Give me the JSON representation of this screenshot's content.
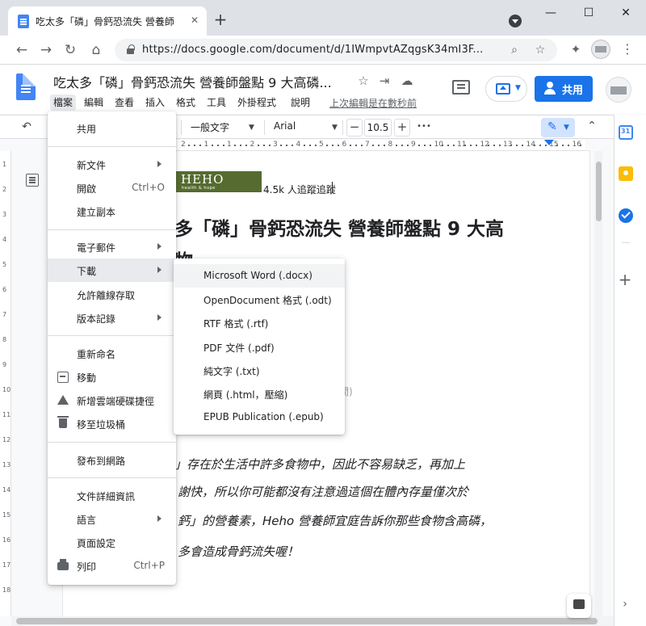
{
  "browser": {
    "tab_title": "吃太多「磷」骨鈣恐流失 營養師",
    "tab_close": "✕",
    "new_tab": "+",
    "window_min": "—",
    "window_max": "☐",
    "window_close": "✕",
    "back": "←",
    "forward": "→",
    "reload": "↻",
    "home": "⌂",
    "url": "https://docs.google.com/document/d/1IWmpvtAZqgsK34mI3F...",
    "zoom_icon": "⌕",
    "star_icon": "☆",
    "extensions_icon": "✦",
    "menu_icon": "⋮"
  },
  "docs": {
    "title": "吃太多「磷」骨鈣恐流失 營養師盤點 9 大高磷...",
    "star_icon": "☆",
    "move_icon": "⇥",
    "cloud_icon": "☁",
    "menus": [
      "檔案",
      "編輯",
      "查看",
      "插入",
      "格式",
      "工具",
      "外掛程式",
      "說明"
    ],
    "last_edit": "上次編輯是在數秒前",
    "share_label": "共用"
  },
  "toolbar": {
    "undo": "↶",
    "style": "一般文字",
    "font": "Arial",
    "size": "10.5",
    "size_minus": "−",
    "size_plus": "+",
    "more": "•••",
    "edit_mode_icon": "✎",
    "collapse": "⌃"
  },
  "ruler": {
    "labels": [
      "2",
      "1",
      "1",
      "2",
      "3",
      "4",
      "5",
      "6",
      "7",
      "8",
      "9",
      "10",
      "11",
      "12",
      "13",
      "14",
      "15",
      "16"
    ],
    "left_labels": [
      "1",
      "2",
      "3",
      "4",
      "5",
      "6",
      "7",
      "8",
      "9",
      "10",
      "11",
      "12",
      "13",
      "14",
      "15",
      "16",
      "17",
      "18"
    ]
  },
  "document": {
    "logo_brand": "HEHO",
    "logo_tagline": "health & hope",
    "followers": "4.5k 人追蹤追蹤",
    "headline_line1": "多「磷」骨鈣恐流失 營養師盤點 9 大高",
    "headline_line2": "物",
    "faint_fragment": "間)",
    "body_lines": [
      "「磷」存在於生活中許多食物中，因此不容易缺乏，再加上",
      "謝快，所以你可能都沒有注意過這個在體內存量僅次於",
      "鈣」的營養素，Heho 營養師宜庭告訴你那些食物含高磷，",
      "多會造成骨鈣流失喔！"
    ]
  },
  "file_menu": {
    "items": [
      {
        "label": "共用",
        "shortcut": "",
        "arrow": false
      },
      {
        "label": "新文件",
        "shortcut": "",
        "arrow": true
      },
      {
        "label": "開啟",
        "shortcut": "Ctrl+O",
        "arrow": false
      },
      {
        "label": "建立副本",
        "shortcut": "",
        "arrow": false
      },
      {
        "label": "電子郵件",
        "shortcut": "",
        "arrow": true
      },
      {
        "label": "下載",
        "shortcut": "",
        "arrow": true
      },
      {
        "label": "允許離線存取",
        "shortcut": "",
        "arrow": false
      },
      {
        "label": "版本記錄",
        "shortcut": "",
        "arrow": true
      },
      {
        "label": "重新命名",
        "shortcut": "",
        "arrow": false
      },
      {
        "label": "移動",
        "shortcut": "",
        "arrow": false
      },
      {
        "label": "新增雲端硬碟捷徑",
        "shortcut": "",
        "arrow": false
      },
      {
        "label": "移至垃圾桶",
        "shortcut": "",
        "arrow": false
      },
      {
        "label": "發布到網路",
        "shortcut": "",
        "arrow": false
      },
      {
        "label": "文件詳細資訊",
        "shortcut": "",
        "arrow": false
      },
      {
        "label": "語言",
        "shortcut": "",
        "arrow": true
      },
      {
        "label": "頁面設定",
        "shortcut": "",
        "arrow": false
      },
      {
        "label": "列印",
        "shortcut": "Ctrl+P",
        "arrow": false
      }
    ]
  },
  "download_menu": {
    "items": [
      "Microsoft Word (.docx)",
      "OpenDocument 格式 (.odt)",
      "RTF 格式 (.rtf)",
      "PDF 文件 (.pdf)",
      "純文字 (.txt)",
      "網頁 (.html，壓縮)",
      "EPUB Publication (.epub)"
    ]
  },
  "side_panel": {
    "add": "+",
    "expand": "›"
  },
  "colors": {
    "accent": "#1a73e8",
    "heho_green": "#556b2f",
    "menu_highlight": "#e8eaed"
  }
}
